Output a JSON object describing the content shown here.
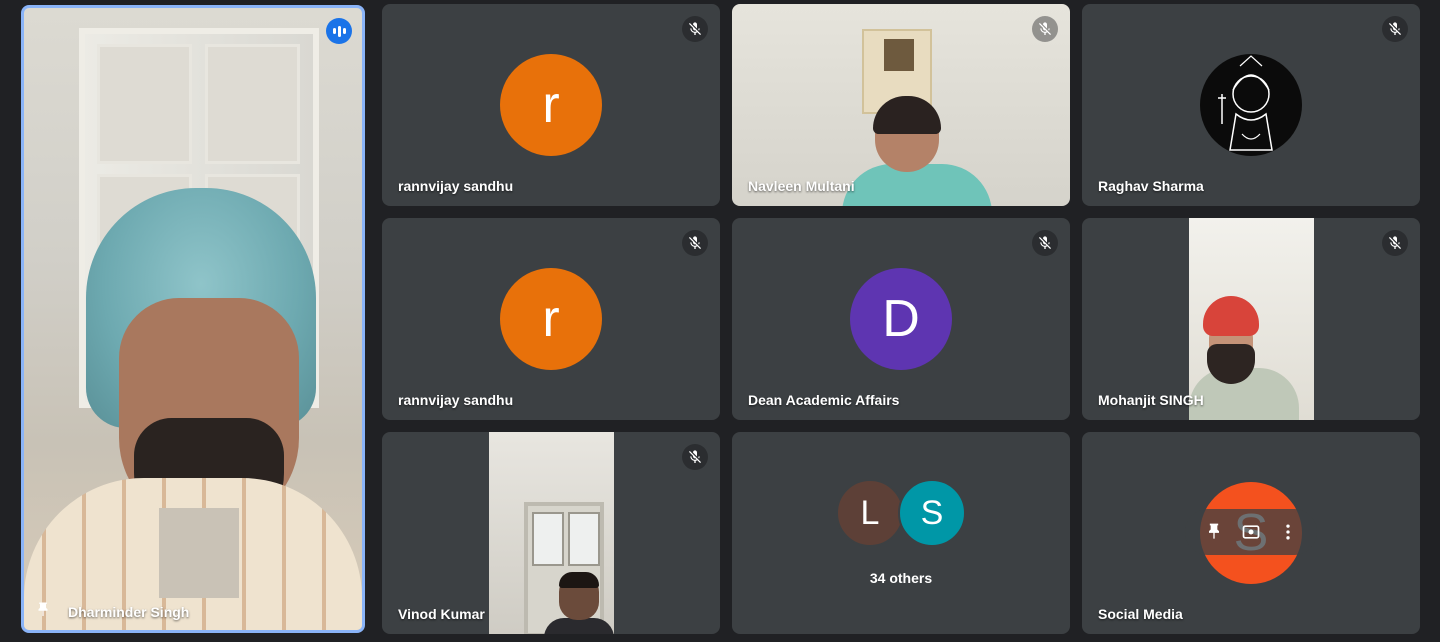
{
  "colors": {
    "background": "#202124",
    "tile": "#3c4043",
    "active_speaker_border": "#8ab4f8",
    "avatar_orange": "#e8710a",
    "avatar_purple": "#5e35b1",
    "avatar_brown": "#5d4037",
    "avatar_teal": "#0097a7",
    "avatar_red_orange": "#f4511e"
  },
  "main_tile": {
    "name": "Dharminder Singh",
    "icon": "pin-icon",
    "speaking_icon": "audio-level-icon"
  },
  "tiles": [
    {
      "name": "rannvijay sandhu",
      "avatar_letter": "r",
      "muted": true
    },
    {
      "name": "Navleen Multani",
      "muted": true
    },
    {
      "name": "Raghav Sharma",
      "muted": true
    },
    {
      "name": "rannvijay sandhu",
      "avatar_letter": "r",
      "muted": true
    },
    {
      "name": "Dean Academic Affairs",
      "avatar_letter": "D",
      "muted": true
    },
    {
      "name": "Mohanjit SINGH",
      "muted": true
    },
    {
      "name": "Vinod Kumar",
      "muted": true
    },
    {
      "others_label": "34 others",
      "avatar_letters": [
        "L",
        "S"
      ]
    },
    {
      "name": "Social Media",
      "avatar_letter": "S",
      "hover_actions": [
        "pin-icon",
        "camera-icon",
        "more-vert-icon"
      ]
    }
  ]
}
